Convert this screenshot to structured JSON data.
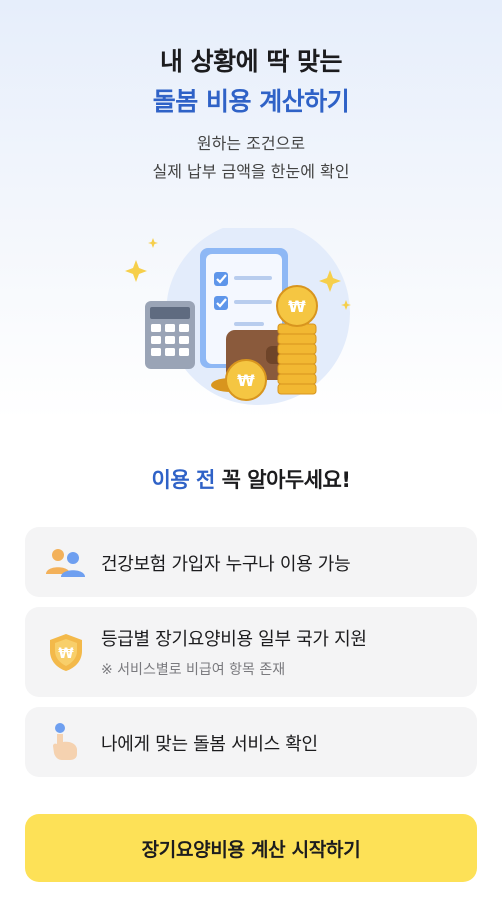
{
  "hero": {
    "title_line1": "내 상황에 딱 맞는",
    "title_line2": "돌봄 비용 계산하기",
    "subtitle_line1": "원하는 조건으로",
    "subtitle_line2": "실제 납부 금액을 한눈에 확인"
  },
  "section": {
    "title_accent": "이용 전",
    "title_rest": " 꼭 알아두세요!"
  },
  "cards": [
    {
      "label": "건강보험 가입자 누구나 이용 가능",
      "icon": "people-icon"
    },
    {
      "label": "등급별 장기요양비용 일부 국가 지원",
      "sub": "※ 서비스별로 비급여 항목 존재",
      "icon": "shield-won-icon"
    },
    {
      "label": "나에게 맞는 돌봄 서비스 확인",
      "icon": "finger-point-icon"
    }
  ],
  "cta": {
    "label": "장기요양비용 계산 시작하기"
  },
  "colors": {
    "accent": "#2f62c7",
    "cta": "#fde157",
    "card_bg": "#f4f4f5"
  }
}
